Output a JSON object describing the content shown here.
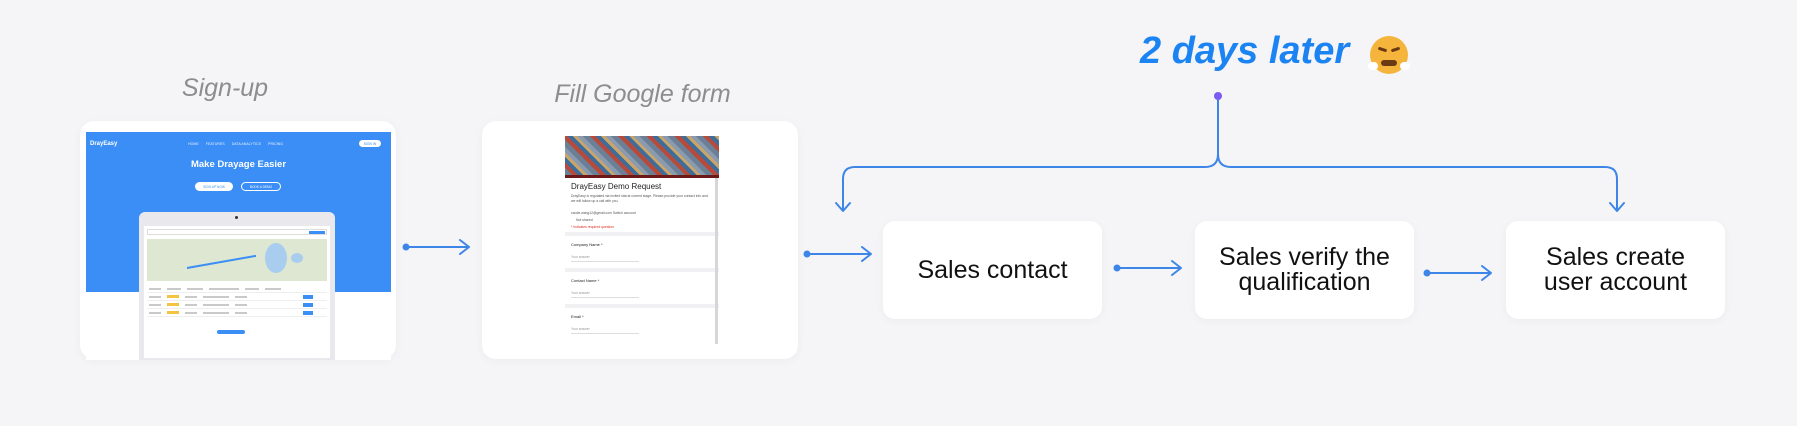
{
  "delay": {
    "label": "2 days later",
    "emoji": "face-with-steam-from-nose-emoji"
  },
  "stages": {
    "signup": {
      "label": "Sign-up",
      "site": {
        "logo": "DrayEasy",
        "nav": [
          "HOME",
          "FEATURES",
          "DATA ANALYTICS",
          "PRICING"
        ],
        "login": "SIGN IN",
        "title": "Make Drayage Easier",
        "primary_cta": "SIGN UP NOW",
        "secondary_cta": "BOOK A DEMO"
      }
    },
    "google_form": {
      "label": "Fill Google form",
      "form": {
        "title": "DrayEasy Demo Request",
        "description": "DrayEasy is regulated via invited stat at current stage. Please provide your contact info and we will follow up a call with you.",
        "email_line": "carole.wang12@gmail.com Switch account",
        "not_shared": "Not shared",
        "required_note": "* Indicates required question",
        "questions": [
          {
            "label": "Company Name *",
            "answer_placeholder": "Your answer"
          },
          {
            "label": "Contact Name *",
            "answer_placeholder": "Your answer"
          },
          {
            "label": "Email *",
            "answer_placeholder": "Your answer"
          }
        ]
      }
    }
  },
  "steps": [
    {
      "label": "Sales contact"
    },
    {
      "label": "Sales verify the qualification"
    },
    {
      "label": "Sales create user account"
    }
  ],
  "colors": {
    "accent": "#1c84f2",
    "arrow": "#3d86e8",
    "node": "#7a5cf0",
    "background": "#f5f5f7"
  }
}
